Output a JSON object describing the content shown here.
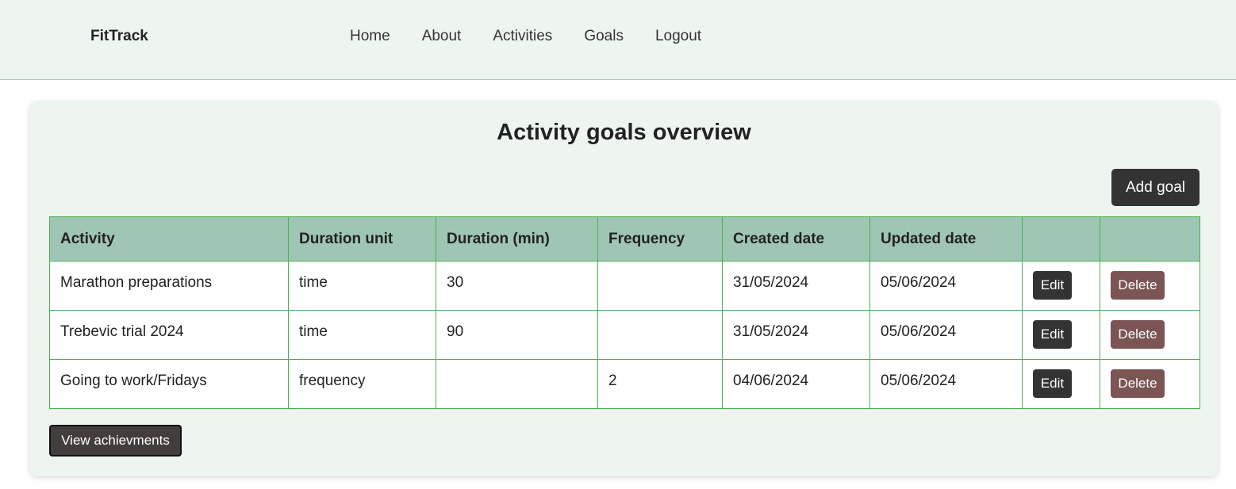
{
  "nav": {
    "brand": "FitTrack",
    "links": [
      "Home",
      "About",
      "Activities",
      "Goals",
      "Logout"
    ]
  },
  "main": {
    "title": "Activity goals overview",
    "add_goal_label": "Add goal",
    "view_achievements_label": "View achievments",
    "table": {
      "headers": [
        "Activity",
        "Duration unit",
        "Duration (min)",
        "Frequency",
        "Created date",
        "Updated date",
        "",
        ""
      ],
      "rows": [
        {
          "activity": "Marathon preparations",
          "duration_unit": "time",
          "duration_min": "30",
          "frequency": "",
          "created": "31/05/2024",
          "updated": "05/06/2024",
          "edit": "Edit",
          "delete": "Delete"
        },
        {
          "activity": "Trebevic trial 2024",
          "duration_unit": "time",
          "duration_min": "90",
          "frequency": "",
          "created": "31/05/2024",
          "updated": "05/06/2024",
          "edit": "Edit",
          "delete": "Delete"
        },
        {
          "activity": "Going to work/Fridays",
          "duration_unit": "frequency",
          "duration_min": "",
          "frequency": "2",
          "created": "04/06/2024",
          "updated": "05/06/2024",
          "edit": "Edit",
          "delete": "Delete"
        }
      ]
    }
  },
  "colors": {
    "nav_bg": "#eef5f0",
    "header_bg": "#9fc6b4",
    "border_green": "#4caf50",
    "button_dark": "#333333",
    "delete_button": "#7a5553"
  }
}
